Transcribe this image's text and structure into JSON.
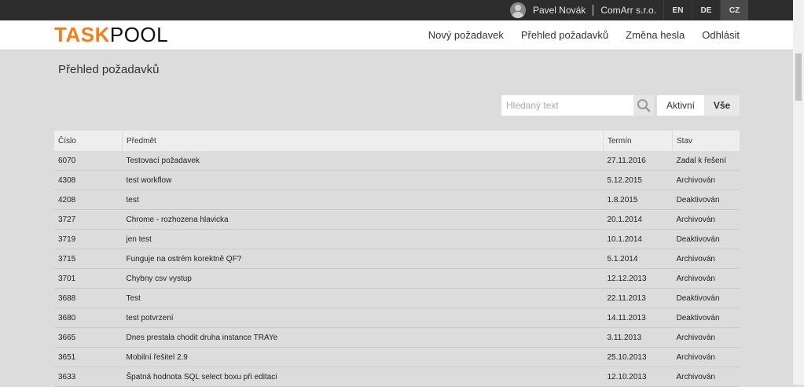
{
  "topbar": {
    "user_name": "Pavel Novák",
    "company": "ComArr s.r.o.",
    "languages": [
      "EN",
      "DE",
      "CZ"
    ]
  },
  "logo": {
    "part1": "TASK",
    "part2": "POOL"
  },
  "nav": {
    "items": [
      "Nový požadavek",
      "Přehled požadavků",
      "Změna hesla",
      "Odhlásit"
    ]
  },
  "page": {
    "title": "Přehled požadavků"
  },
  "search": {
    "placeholder": "Hledaný text",
    "value": ""
  },
  "filters": {
    "active": "Aktivní",
    "all": "Vše"
  },
  "table": {
    "headers": [
      "Číslo",
      "Předmět",
      "Termín",
      "Stav"
    ],
    "rows": [
      [
        "6070",
        "Testovací požadavek",
        "27.11.2016",
        "Zadal k řešení"
      ],
      [
        "4308",
        "test workflow",
        "5.12.2015",
        "Archivován"
      ],
      [
        "4208",
        "test",
        "1.8.2015",
        "Deaktivován"
      ],
      [
        "3727",
        "Chrome - rozhozena hlavicka",
        "20.1.2014",
        "Archivován"
      ],
      [
        "3719",
        "jen test",
        "10.1.2014",
        "Deaktivován"
      ],
      [
        "3715",
        "Funguje na ostrém korektně QF?",
        "5.1.2014",
        "Archivován"
      ],
      [
        "3701",
        "Chybny csv vystup",
        "12.12.2013",
        "Archivován"
      ],
      [
        "3688",
        "Test",
        "22.11.2013",
        "Deaktivován"
      ],
      [
        "3680",
        "test potvrzení",
        "14.11.2013",
        "Deaktivován"
      ],
      [
        "3665",
        "Dnes prestala chodit druha instance TRAYe",
        "3.11.2013",
        "Archivován"
      ],
      [
        "3651",
        "Mobilní řešitel 2.9",
        "25.10.2013",
        "Archivován"
      ],
      [
        "3633",
        "Špatná hodnota SQL select boxu při editaci",
        "12.10.2013",
        "Archivován"
      ]
    ]
  },
  "colors": {
    "brand": "#f07f1d",
    "topbar": "#2d2d2d",
    "background": "#dcdcdc"
  },
  "icons": {
    "search": "search-icon",
    "user": "user-avatar-icon"
  }
}
